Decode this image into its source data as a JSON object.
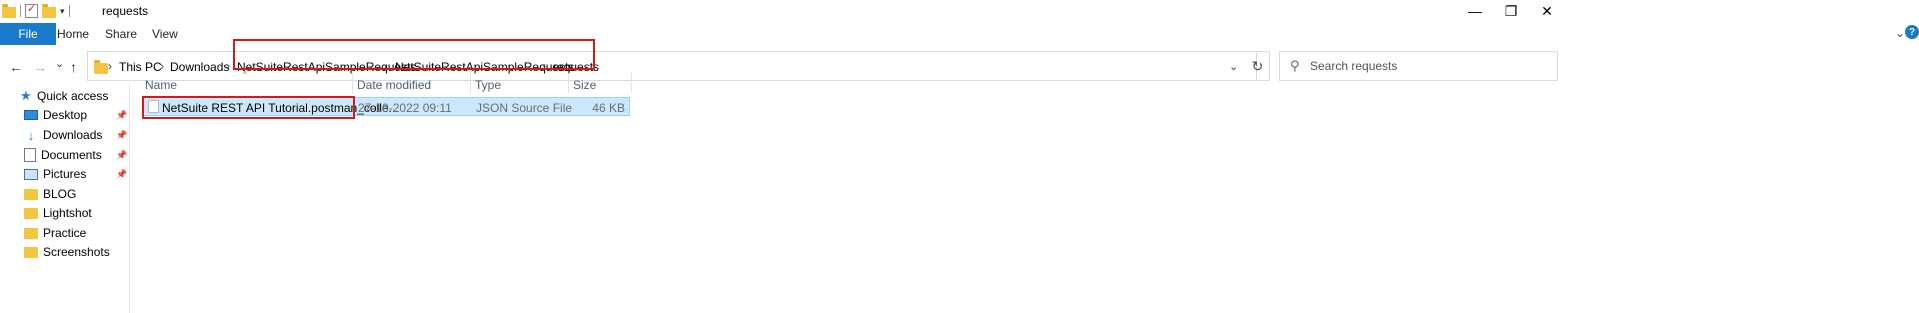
{
  "window": {
    "title": "requests",
    "minimize_glyph": "—",
    "restore_glyph": "❐",
    "close_glyph": "✕"
  },
  "ribbon": {
    "tabs": [
      {
        "label": "File"
      },
      {
        "label": "Home"
      },
      {
        "label": "Share"
      },
      {
        "label": "View"
      }
    ],
    "expand_glyph": "⌄",
    "help_glyph": "?"
  },
  "nav": {
    "back_glyph": "←",
    "forward_glyph": "→",
    "recent_glyph": "⌄",
    "up_glyph": "↑"
  },
  "address": {
    "crumbs": [
      {
        "label": "This PC"
      },
      {
        "label": "Downloads"
      },
      {
        "label": "NetSuiteRestApiSampleRequests"
      },
      {
        "label": "NetSuiteRestApiSampleRequests"
      },
      {
        "label": "requests"
      }
    ],
    "separator": "›",
    "dropdown_glyph": "⌄",
    "refresh_glyph": "↻"
  },
  "search": {
    "placeholder": "Search requests",
    "icon_glyph": "⚲"
  },
  "sidebar": {
    "items": [
      {
        "label": "Quick access",
        "icon": "star-icon",
        "pinned": false
      },
      {
        "label": "Desktop",
        "icon": "desktop-icon",
        "pinned": true
      },
      {
        "label": "Downloads",
        "icon": "download-icon",
        "pinned": true
      },
      {
        "label": "Documents",
        "icon": "documents-icon",
        "pinned": true
      },
      {
        "label": "Pictures",
        "icon": "pictures-icon",
        "pinned": true
      },
      {
        "label": "BLOG",
        "icon": "folder-icon",
        "pinned": false
      },
      {
        "label": "Lightshot",
        "icon": "folder-icon",
        "pinned": false
      },
      {
        "label": "Practice",
        "icon": "folder-icon",
        "pinned": false
      },
      {
        "label": "Screenshots",
        "icon": "folder-icon",
        "pinned": false
      }
    ],
    "pin_glyph": "📌"
  },
  "filelist": {
    "columns": [
      "Name",
      "Date modified",
      "Type",
      "Size"
    ],
    "sort_glyph": "^",
    "rows": [
      {
        "name": "NetSuite REST API Tutorial.postman_colle...",
        "date_modified": "27-10-2022 09:11",
        "type": "JSON Source File",
        "size": "46 KB",
        "selected": true
      }
    ]
  },
  "colors": {
    "accent": "#1979ca",
    "selection": "#cce8ff",
    "highlight_box": "#d11a1a"
  }
}
